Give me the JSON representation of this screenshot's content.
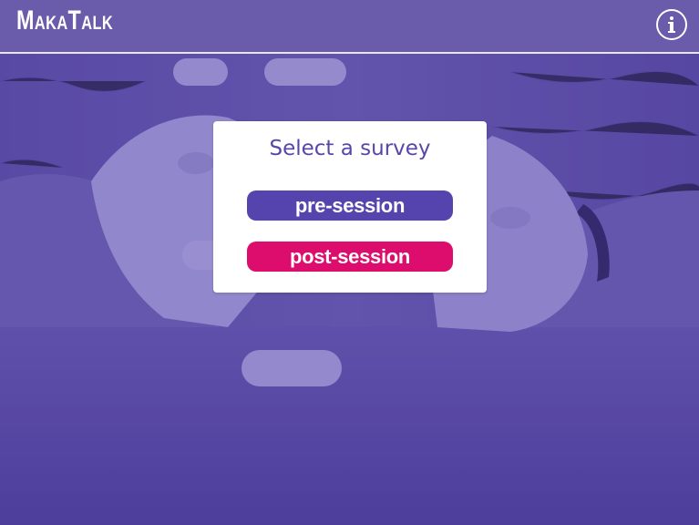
{
  "app": {
    "title": "MakaTalk"
  },
  "header": {
    "info_icon": "info-circle-icon"
  },
  "dialog": {
    "title": "Select a survey",
    "buttons": [
      {
        "label": "pre-session",
        "color": "#5544ae"
      },
      {
        "label": "post-session",
        "color": "#dc0d6d"
      }
    ]
  },
  "colors": {
    "header": "#6a5caa",
    "background_tint": "#5a4aa6",
    "title_text": "#5a46a8"
  },
  "background": {
    "description_icon": "clasped-hands-photo"
  }
}
